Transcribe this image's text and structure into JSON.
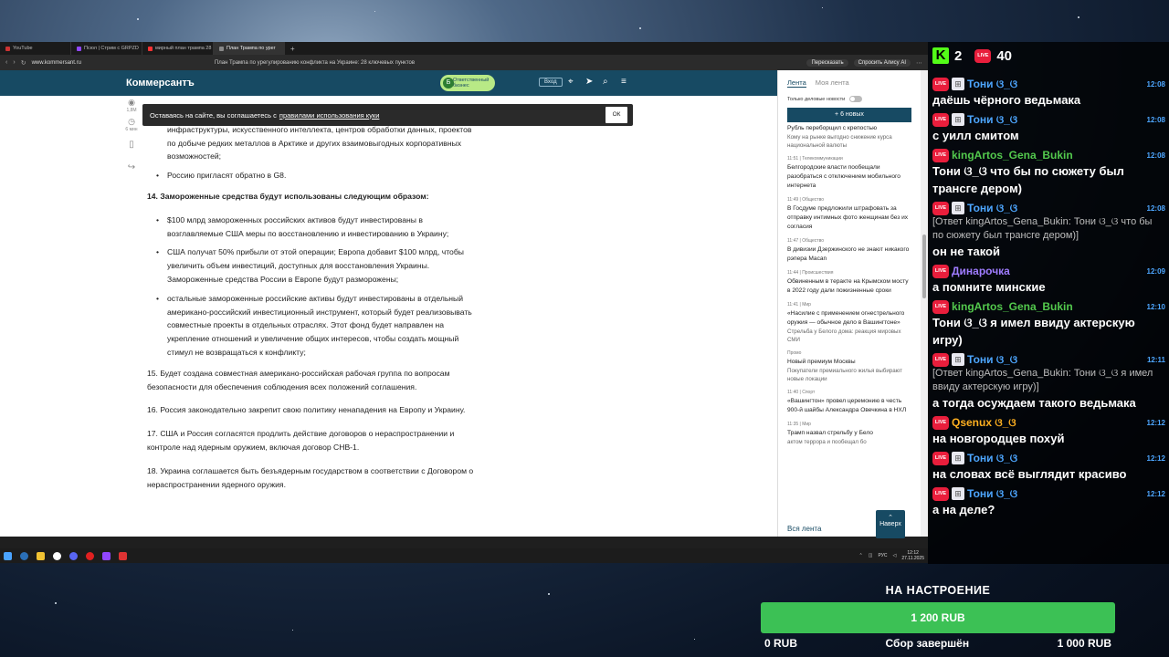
{
  "browser": {
    "tabs": [
      {
        "label": "YouTube",
        "active": false
      },
      {
        "label": "Псюл | Стрим с GRPZD",
        "active": false
      },
      {
        "label": "мирный план трампа 28",
        "active": false
      },
      {
        "label": "План Трампа по урег",
        "active": true
      }
    ],
    "url": "www.kommersant.ru",
    "page_title": "План Трампа по урегулированию конфликта на Украине: 28 ключевых пунктов",
    "toolbar_chips": [
      "Пересказать",
      "Спросить Алису AI"
    ]
  },
  "site": {
    "logo": "Коммерсантъ",
    "responsible_business": "Ответственный бизнес",
    "login_label": "Вход",
    "left_tools": {
      "views": "1,8М",
      "time": "6 мин"
    }
  },
  "cookie": {
    "text": "Оставаясь на сайте, вы соглашаетесь с",
    "link": "правилами использования куки",
    "ok_label": "ОК"
  },
  "article": {
    "bullets_top": [
      "для взаимного развития в сферах энергетики, природных ресурсов, инфраструктуры, искусственного интеллекта, центров обработки данных, проектов по добыче редких металлов в Арктике и других взаимовыгодных корпоративных возможностей;",
      "Россию пригласят обратно в G8."
    ],
    "heading_14": "14. Замороженные средства будут использованы следующим образом:",
    "bullets_14": [
      "$100 млрд замороженных российских активов будут инвестированы в возглавляемые США меры по восстановлению и инвестированию в Украину;",
      "США получат 50% прибыли от этой операции; Европа добавит $100 млрд, чтобы увеличить объем инвестиций, доступных для восстановления Украины. Замороженные средства России в Европе будут разморожены;",
      "остальные замороженные российские активы будут инвестированы в отдельный американо-российский инвестиционный инструмент, который будет реализовывать совместные проекты в отдельных отраслях. Этот фонд будет направлен на укрепление отношений и увеличение общих интересов, чтобы создать мощный стимул не возвращаться к конфликту;"
    ],
    "p15": "15. Будет создана совместная американо-российская рабочая группа по вопросам безопасности для обеспечения соблюдения всех положений соглашения.",
    "p16": "16. Россия законодательно закрепит свою политику ненападения на Европу и Украину.",
    "p17": "17. США и Россия согласятся продлить действие договоров о нераспространении и контроле над ядерным оружием, включая договор СНВ-1.",
    "p18": "18. Украина соглашается быть безъядерным государством в соответствии с Договором о нераспространении ядерного оружия."
  },
  "feed": {
    "tabs": [
      "Лента",
      "Моя лента"
    ],
    "toggle_label": "Только деловые новости",
    "new_button": "+ 6 новых",
    "items": [
      {
        "tag": "",
        "title": "Рубль переборщил с крепостью",
        "sub": "Кому на рынке выгодно снижение курса национальной валюты"
      },
      {
        "tag": "11:51 | Телекоммуникации",
        "title": "Белгородские власти пообещали разобраться с отключением мобильного интернета",
        "sub": ""
      },
      {
        "tag": "11:49 | Общество",
        "title": "В Госдуме предложили штрафовать за отправку интимных фото женщинам без их согласия",
        "sub": ""
      },
      {
        "tag": "11:47 | Общество",
        "title": "В дивизии Дзержинского не знают никакого рэпера Macan",
        "sub": ""
      },
      {
        "tag": "11:44 | Происшествия",
        "title": "Обвиненным в теракте на Крымском мосту в 2022 году дали пожизненные сроки",
        "sub": ""
      },
      {
        "tag": "11:41 | Мир",
        "title": "«Насилие с применением огнестрельного оружия — обычное дело в Вашингтоне»",
        "sub": "Стрельба у Белого дома: реакция мировых СМИ"
      },
      {
        "tag": "Промо",
        "title": "Новый премиум Москвы",
        "sub": "Покупатели премиального жилья выбирают новые локации"
      },
      {
        "tag": "11:40 | Спорт",
        "title": "«Вашингтон» провел церемонию в честь 900-й шайбы Александра Овечкина в НХЛ",
        "sub": ""
      },
      {
        "tag": "11:35 | Мир",
        "title": "Трамп назвал стрельбу у Бело",
        "sub": "актом террора и пообещал бо"
      }
    ],
    "all_label": "Вся лента",
    "up_label": "Наверх"
  },
  "taskbar": {
    "lang": "РУС",
    "time": "12:12",
    "date": "27.11.2025"
  },
  "chat": {
    "kick_viewers": "2",
    "live_viewers": "40",
    "badge_live": "LIVE",
    "messages": [
      {
        "name": "Тони ଓ_ଓ",
        "color": "#4da6ff",
        "time": "12:08",
        "text": "даёшь чёрного ведьмака",
        "reply": false,
        "gift": true
      },
      {
        "name": "Тони ଓ_ଓ",
        "color": "#4da6ff",
        "time": "12:08",
        "text": "с уилл смитом",
        "reply": false,
        "gift": true
      },
      {
        "name": "kingArtos_Gena_Bukin",
        "color": "#53c94d",
        "time": "12:08",
        "text": "Тони ଓ_ଓ что бы по сюжету был трансге дером)",
        "reply": false,
        "gift": false
      },
      {
        "name": "Тони ଓ_ଓ",
        "color": "#4da6ff",
        "time": "12:08",
        "text": "[Ответ kingArtos_Gena_Bukin: Тони ଓ_ଓ что бы по сюжету был трансге дером)]",
        "reply": true,
        "gift": true,
        "after": "он не такой"
      },
      {
        "name": "Динарочка",
        "color": "#9f7cff",
        "time": "12:09",
        "text": "а помните минские",
        "reply": false,
        "gift": false
      },
      {
        "name": "kingArtos_Gena_Bukin",
        "color": "#53c94d",
        "time": "12:10",
        "text": "Тони ଓ_ଓ я имел ввиду актерскую игру)",
        "reply": false,
        "gift": false
      },
      {
        "name": "Тони ଓ_ଓ",
        "color": "#4da6ff",
        "time": "12:11",
        "text": "[Ответ kingArtos_Gena_Bukin: Тони ଓ_ଓ я имел ввиду актерскую игру)]",
        "reply": true,
        "gift": true,
        "after": "а тогда осуждаем такого ведьмака"
      },
      {
        "name": "Qsenux ଓ_ଓ",
        "color": "#ffb020",
        "time": "12:12",
        "text": "на новгородцев похуй",
        "reply": false,
        "gift": false
      },
      {
        "name": "Тони ଓ_ଓ",
        "color": "#4da6ff",
        "time": "12:12",
        "text": "на словах всё выглядит красиво",
        "reply": false,
        "gift": true
      },
      {
        "name": "Тони ଓ_ଓ",
        "color": "#4da6ff",
        "time": "12:12",
        "text": "а на деле?",
        "reply": false,
        "gift": true
      }
    ]
  },
  "donation": {
    "title": "НА НАСТРОЕНИЕ",
    "raised": "1 200 RUB",
    "min": "0 RUB",
    "status": "Сбор завершён",
    "goal": "1 000 RUB",
    "progress": 1.0
  }
}
